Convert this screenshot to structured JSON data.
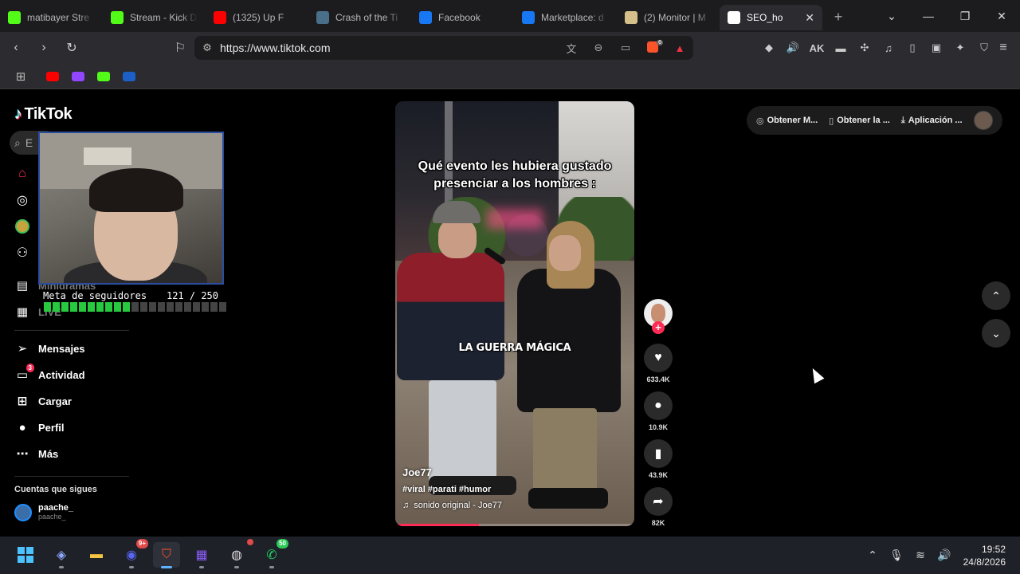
{
  "browser": {
    "tabs": [
      {
        "label": "matibayer Stre",
        "icon": "kick-icon",
        "color": "#53fc18"
      },
      {
        "label": "Stream - Kick D",
        "icon": "kick-icon",
        "color": "#53fc18"
      },
      {
        "label": "(1325) Up F",
        "icon": "youtube-icon",
        "color": "#ff0000"
      },
      {
        "label": "Crash of the Ti",
        "icon": "page-icon",
        "color": "#4a6f8a"
      },
      {
        "label": "Facebook",
        "icon": "facebook-icon",
        "color": "#1877f2"
      },
      {
        "label": "Marketplace: d",
        "icon": "facebook-icon",
        "color": "#1877f2"
      },
      {
        "label": "(2) Monitor | M",
        "icon": "monitor-icon",
        "color": "#d6c08a"
      },
      {
        "label": "SEO_ho",
        "icon": "tiktok-icon",
        "color": "#ffffff",
        "active": true
      }
    ],
    "url": "https://www.tiktok.com",
    "bookmarks": [
      {
        "name": "youtube",
        "color": "#ff0000"
      },
      {
        "name": "twitch",
        "color": "#9146ff"
      },
      {
        "name": "kick",
        "color": "#53fc18"
      },
      {
        "name": "other",
        "color": "#1c5fc7"
      }
    ],
    "notification_badge": "6"
  },
  "tiktok": {
    "logo": "TikTok",
    "search_placeholder": "E",
    "sidebar": [
      {
        "label": "Mensajes",
        "icon": "send-icon"
      },
      {
        "label": "Actividad",
        "icon": "inbox-icon",
        "badge": "3"
      },
      {
        "label": "Cargar",
        "icon": "upload-icon"
      },
      {
        "label": "Perfil",
        "icon": "profile-icon"
      },
      {
        "label": "Más",
        "icon": "more-icon"
      }
    ],
    "partial_items": [
      "Minidramas",
      "LIVE"
    ],
    "following_title": "Cuentas que sigues",
    "following": [
      {
        "name": "paache_",
        "handle": "paache_"
      }
    ],
    "top_buttons": [
      "Obtener M...",
      "Obtener la ...",
      "Aplicación ..."
    ],
    "video": {
      "caption_line1": "Qué evento les hubiera gustado",
      "caption_line2": "presenciar a los hombres :",
      "subtitle": "LA GUERRA MÁGICA",
      "author": "Joe77",
      "tags": "#viral #parati #humor",
      "music": "sonido original - Joe77",
      "progress": 0.35
    },
    "actions": {
      "likes": "633.4K",
      "comments": "10.9K",
      "saves": "43.9K",
      "shares": "82K"
    }
  },
  "overlay": {
    "goal_label": "Meta de seguidores",
    "goal_value": "121 / 250",
    "goal_filled": 10,
    "goal_total": 21
  },
  "taskbar": {
    "time": "19:52",
    "date": "24/8/2026",
    "discord_badge": "9+",
    "whatsapp_badge": "50"
  }
}
